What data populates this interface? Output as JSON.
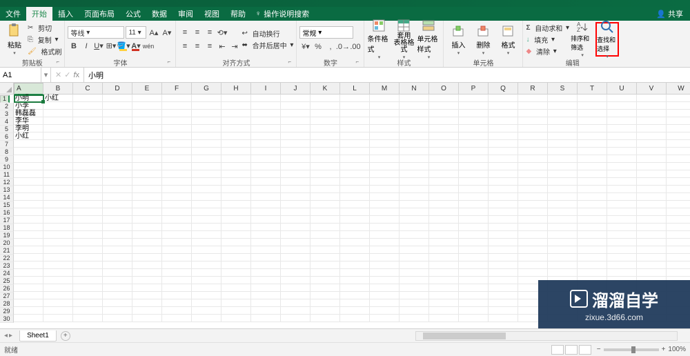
{
  "tabs": {
    "file": "文件",
    "home": "开始",
    "insert": "插入",
    "pagelayout": "页面布局",
    "formulas": "公式",
    "data": "数据",
    "review": "审阅",
    "view": "视图",
    "help": "帮助",
    "searchop": "操作说明搜索"
  },
  "share": "共享",
  "clipboard": {
    "paste": "粘贴",
    "cut": "剪切",
    "copy": "复制",
    "formatpainter": "格式刷",
    "label": "剪贴板"
  },
  "font": {
    "name": "等线",
    "size": "11",
    "label": "字体"
  },
  "alignment": {
    "wrap": "自动换行",
    "merge": "合并后居中",
    "label": "对齐方式"
  },
  "number": {
    "format": "常规",
    "label": "数字"
  },
  "styles": {
    "cond": "条件格式",
    "table": "套用\n表格格式",
    "cell": "单元格样式",
    "label": "样式"
  },
  "cells": {
    "insert": "插入",
    "delete": "删除",
    "format": "格式",
    "label": "单元格"
  },
  "editing": {
    "autosum": "自动求和",
    "fill": "填充",
    "clear": "清除",
    "sort": "排序和筛选",
    "find": "查找和选择",
    "label": "编辑"
  },
  "namebox": "A1",
  "formula": "小明",
  "columns": [
    "A",
    "B",
    "C",
    "D",
    "E",
    "F",
    "G",
    "H",
    "I",
    "J",
    "K",
    "L",
    "M",
    "N",
    "O",
    "P",
    "Q",
    "R",
    "S",
    "T",
    "U",
    "V",
    "W"
  ],
  "rows": 30,
  "data": [
    [
      "小明",
      "小红"
    ],
    [
      "小李"
    ],
    [
      "韩磊磊"
    ],
    [
      "李华"
    ],
    [
      "李明"
    ],
    [
      "小红"
    ]
  ],
  "sheet": "Sheet1",
  "status": "就绪",
  "zoom": "100%",
  "watermark": {
    "title": "溜溜自学",
    "url": "zixue.3d66.com"
  }
}
